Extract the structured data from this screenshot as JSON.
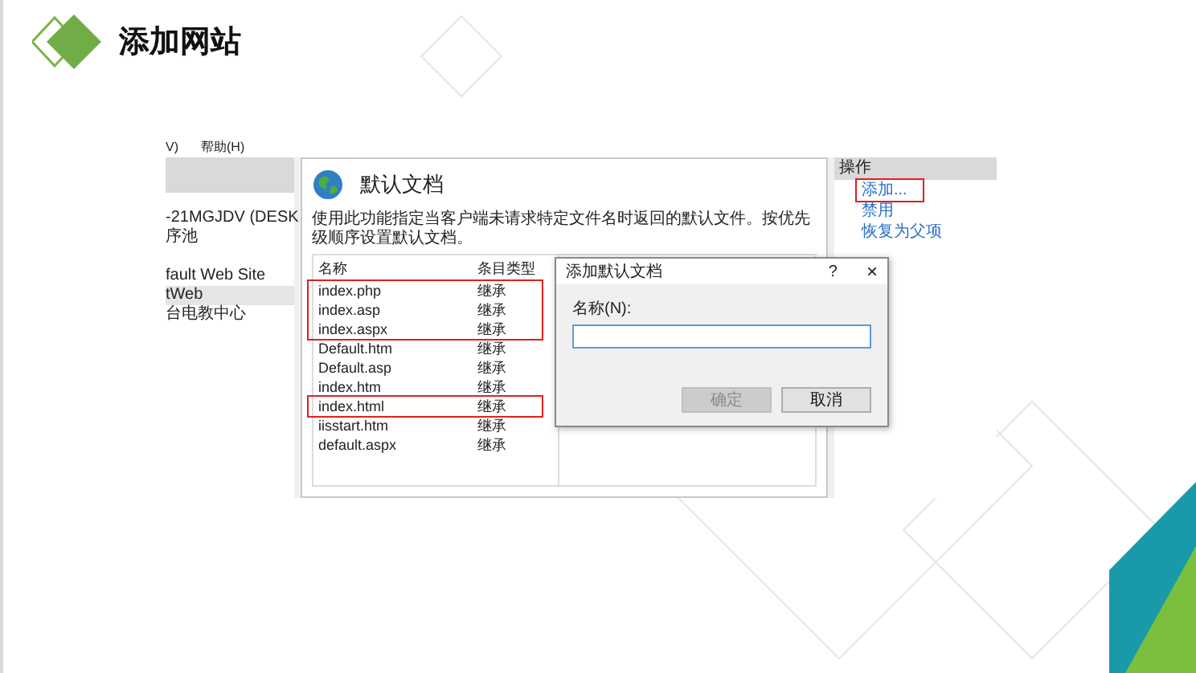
{
  "slide": {
    "title": "添加网站"
  },
  "window": {
    "menu": [
      {
        "label": "V)"
      },
      {
        "label": "帮助(H)"
      }
    ],
    "tree": [
      {
        "label": "-21MGJDV (DESK",
        "selected": false
      },
      {
        "label": "序池",
        "selected": false
      },
      {
        "label": "fault Web Site",
        "selected": false
      },
      {
        "label": "tWeb",
        "selected": true
      },
      {
        "label": "台电教中心",
        "selected": false
      }
    ],
    "feature": {
      "title": "默认文档",
      "description": "使用此功能指定当客户端未请求特定文件名时返回的默认文件。按优先级顺序设置默认文档。",
      "columns": [
        "名称",
        "条目类型"
      ],
      "row_groups": [
        {
          "marked": true,
          "rows": [
            [
              "index.php",
              "继承"
            ],
            [
              "index.asp",
              "继承"
            ],
            [
              "index.aspx",
              "继承"
            ]
          ]
        },
        {
          "marked": false,
          "rows": [
            [
              "Default.htm",
              "继承"
            ],
            [
              "Default.asp",
              "继承"
            ],
            [
              "index.htm",
              "继承"
            ]
          ]
        },
        {
          "marked": true,
          "rows": [
            [
              "index.html",
              "继承"
            ]
          ]
        },
        {
          "marked": false,
          "rows": [
            [
              "iisstart.htm",
              "继承"
            ],
            [
              "default.aspx",
              "继承"
            ]
          ]
        }
      ]
    },
    "actions": {
      "title": "操作",
      "items": [
        {
          "label": "添加...",
          "marked": true
        },
        {
          "label": "禁用",
          "marked": false
        },
        {
          "label": "恢复为父项",
          "marked": false
        }
      ]
    },
    "dialog": {
      "title": "添加默认文档",
      "help": "?",
      "close": "×",
      "field_label": "名称(N):",
      "buttons": [
        {
          "label": "确定",
          "disabled": true
        },
        {
          "label": "取消",
          "disabled": false
        }
      ]
    }
  }
}
